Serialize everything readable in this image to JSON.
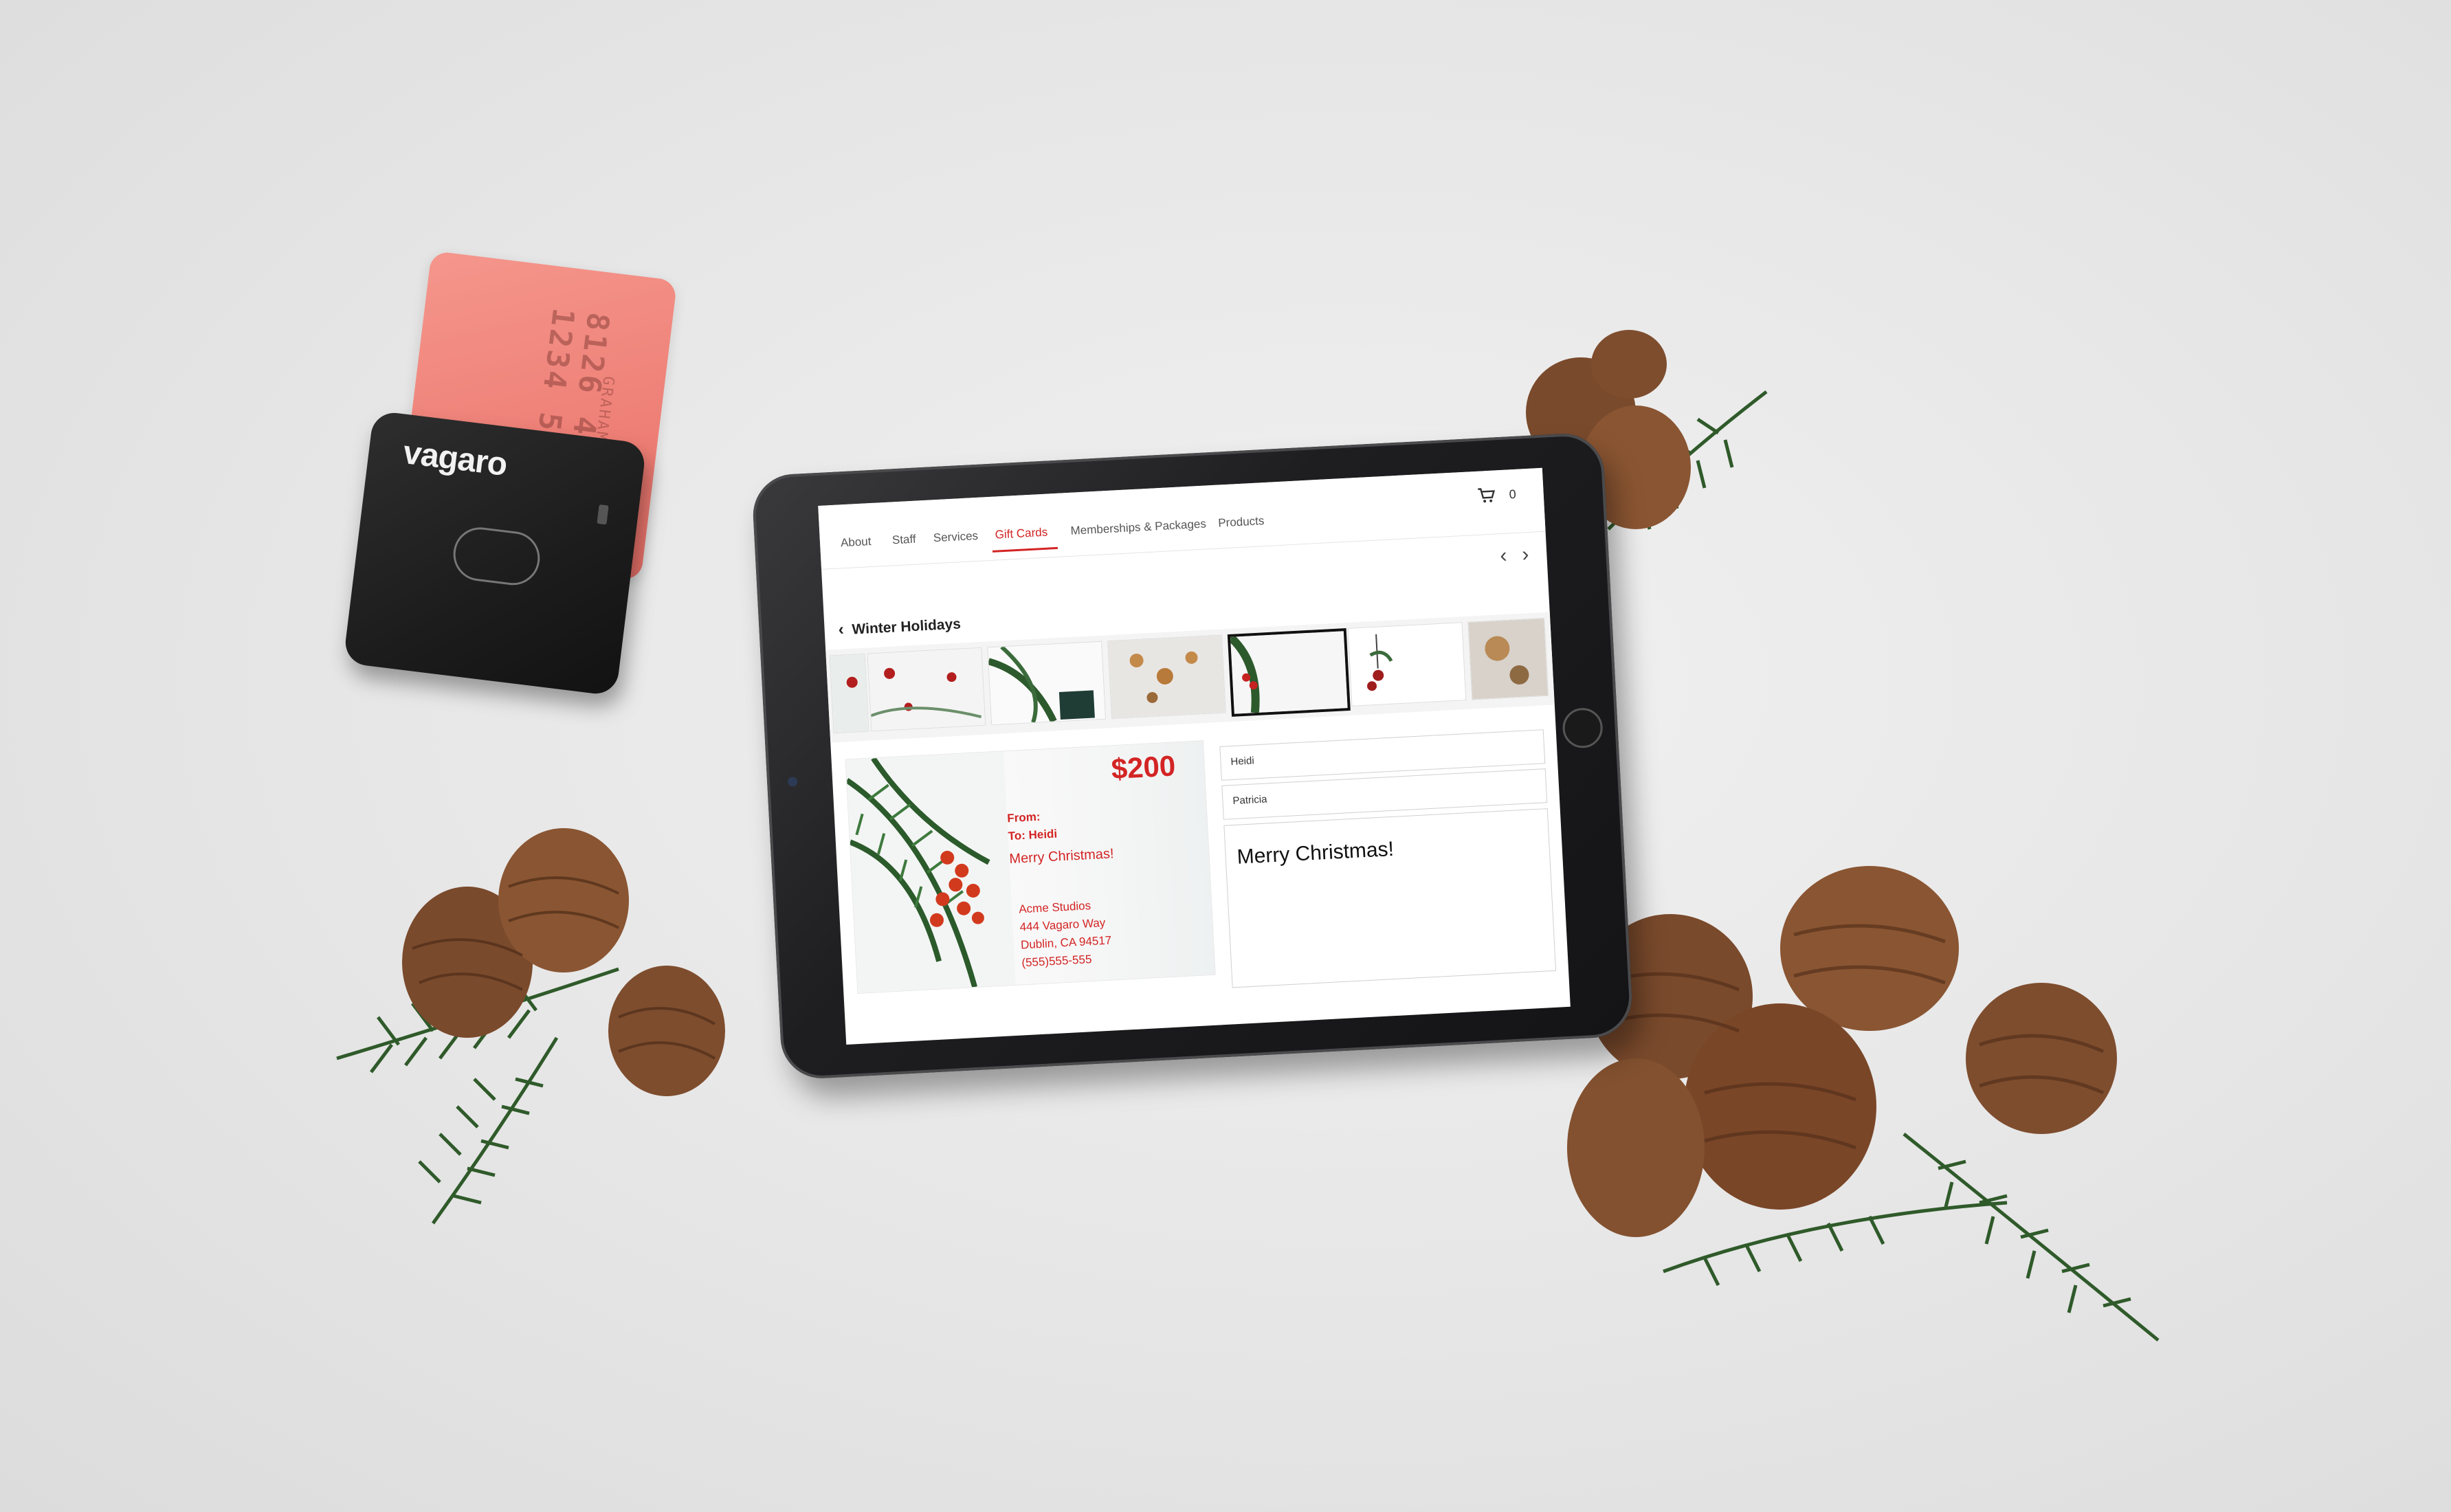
{
  "reader": {
    "brand": "vagaro",
    "card_number": "8126 4862 1234 56",
    "card_name": "GRAHAM"
  },
  "nav": {
    "items": [
      {
        "label": "About"
      },
      {
        "label": "Staff"
      },
      {
        "label": "Services"
      },
      {
        "label": "Gift Cards",
        "active": true
      },
      {
        "label": "Memberships & Packages"
      },
      {
        "label": "Products"
      }
    ],
    "cart_count": "0"
  },
  "category": {
    "title": "Winter Holidays"
  },
  "preview": {
    "amount": "$200",
    "from_label": "From:",
    "to_label": "To: Heidi",
    "message": "Merry Christmas!",
    "address": [
      "Acme Studios",
      "444 Vagaro Way",
      "Dublin, CA 94517",
      "(555)555-555"
    ]
  },
  "form": {
    "to_value": "Heidi",
    "from_value": "Patricia",
    "message_value": "Merry Christmas!"
  },
  "colors": {
    "accent": "#d32424",
    "card_pink": "#f08a80",
    "device_black": "#1c1c1c"
  },
  "icons": {
    "cart": "cart-icon",
    "prev": "chevron-left-icon",
    "next": "chevron-right-icon",
    "back": "chevron-left-icon",
    "nfc": "contactless-icon"
  }
}
